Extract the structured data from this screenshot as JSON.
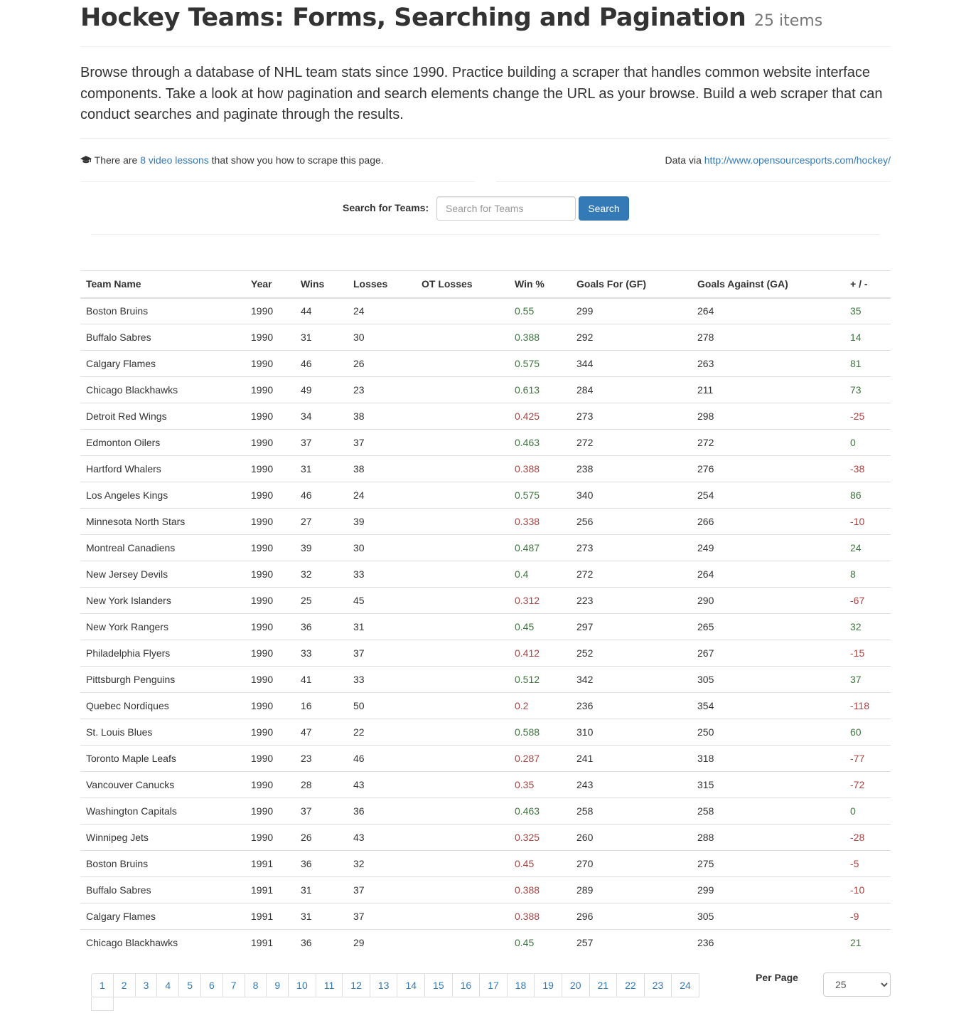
{
  "header": {
    "title": "Hockey Teams: Forms, Searching and Pagination",
    "count": "25 items"
  },
  "intro": "Browse through a database of NHL team stats since 1990. Practice building a scraper that handles common website interface components. Take a look at how pagination and search elements change the URL as your browse. Build a web scraper that can conduct searches and paginate through the results.",
  "info": {
    "icon": "graduation-cap-icon",
    "prefix": "There are",
    "lessons_link": "8 video lessons",
    "suffix": "that show you how to scrape this page.",
    "data_via": "Data via",
    "source_link": "http://www.opensourcesports.com/hockey/"
  },
  "search": {
    "label": "Search for Teams:",
    "placeholder": "Search for Teams",
    "value": "",
    "button": "Search"
  },
  "table": {
    "columns": [
      "Team Name",
      "Year",
      "Wins",
      "Losses",
      "OT Losses",
      "Win %",
      "Goals For (GF)",
      "Goals Against (GA)",
      "+ / -"
    ],
    "rows": [
      {
        "name": "Boston Bruins",
        "year": "1990",
        "wins": "44",
        "losses": "24",
        "ot": "",
        "pct": "0.55",
        "gf": "299",
        "ga": "264",
        "diff": "35",
        "status": "pos"
      },
      {
        "name": "Buffalo Sabres",
        "year": "1990",
        "wins": "31",
        "losses": "30",
        "ot": "",
        "pct": "0.388",
        "gf": "292",
        "ga": "278",
        "diff": "14",
        "status": "pos"
      },
      {
        "name": "Calgary Flames",
        "year": "1990",
        "wins": "46",
        "losses": "26",
        "ot": "",
        "pct": "0.575",
        "gf": "344",
        "ga": "263",
        "diff": "81",
        "status": "pos"
      },
      {
        "name": "Chicago Blackhawks",
        "year": "1990",
        "wins": "49",
        "losses": "23",
        "ot": "",
        "pct": "0.613",
        "gf": "284",
        "ga": "211",
        "diff": "73",
        "status": "pos"
      },
      {
        "name": "Detroit Red Wings",
        "year": "1990",
        "wins": "34",
        "losses": "38",
        "ot": "",
        "pct": "0.425",
        "gf": "273",
        "ga": "298",
        "diff": "-25",
        "status": "neg"
      },
      {
        "name": "Edmonton Oilers",
        "year": "1990",
        "wins": "37",
        "losses": "37",
        "ot": "",
        "pct": "0.463",
        "gf": "272",
        "ga": "272",
        "diff": "0",
        "status": "pos"
      },
      {
        "name": "Hartford Whalers",
        "year": "1990",
        "wins": "31",
        "losses": "38",
        "ot": "",
        "pct": "0.388",
        "gf": "238",
        "ga": "276",
        "diff": "-38",
        "status": "neg"
      },
      {
        "name": "Los Angeles Kings",
        "year": "1990",
        "wins": "46",
        "losses": "24",
        "ot": "",
        "pct": "0.575",
        "gf": "340",
        "ga": "254",
        "diff": "86",
        "status": "pos"
      },
      {
        "name": "Minnesota North Stars",
        "year": "1990",
        "wins": "27",
        "losses": "39",
        "ot": "",
        "pct": "0.338",
        "gf": "256",
        "ga": "266",
        "diff": "-10",
        "status": "neg"
      },
      {
        "name": "Montreal Canadiens",
        "year": "1990",
        "wins": "39",
        "losses": "30",
        "ot": "",
        "pct": "0.487",
        "gf": "273",
        "ga": "249",
        "diff": "24",
        "status": "pos"
      },
      {
        "name": "New Jersey Devils",
        "year": "1990",
        "wins": "32",
        "losses": "33",
        "ot": "",
        "pct": "0.4",
        "gf": "272",
        "ga": "264",
        "diff": "8",
        "status": "pos"
      },
      {
        "name": "New York Islanders",
        "year": "1990",
        "wins": "25",
        "losses": "45",
        "ot": "",
        "pct": "0.312",
        "gf": "223",
        "ga": "290",
        "diff": "-67",
        "status": "neg"
      },
      {
        "name": "New York Rangers",
        "year": "1990",
        "wins": "36",
        "losses": "31",
        "ot": "",
        "pct": "0.45",
        "gf": "297",
        "ga": "265",
        "diff": "32",
        "status": "pos"
      },
      {
        "name": "Philadelphia Flyers",
        "year": "1990",
        "wins": "33",
        "losses": "37",
        "ot": "",
        "pct": "0.412",
        "gf": "252",
        "ga": "267",
        "diff": "-15",
        "status": "neg"
      },
      {
        "name": "Pittsburgh Penguins",
        "year": "1990",
        "wins": "41",
        "losses": "33",
        "ot": "",
        "pct": "0.512",
        "gf": "342",
        "ga": "305",
        "diff": "37",
        "status": "pos"
      },
      {
        "name": "Quebec Nordiques",
        "year": "1990",
        "wins": "16",
        "losses": "50",
        "ot": "",
        "pct": "0.2",
        "gf": "236",
        "ga": "354",
        "diff": "-118",
        "status": "neg"
      },
      {
        "name": "St. Louis Blues",
        "year": "1990",
        "wins": "47",
        "losses": "22",
        "ot": "",
        "pct": "0.588",
        "gf": "310",
        "ga": "250",
        "diff": "60",
        "status": "pos"
      },
      {
        "name": "Toronto Maple Leafs",
        "year": "1990",
        "wins": "23",
        "losses": "46",
        "ot": "",
        "pct": "0.287",
        "gf": "241",
        "ga": "318",
        "diff": "-77",
        "status": "neg"
      },
      {
        "name": "Vancouver Canucks",
        "year": "1990",
        "wins": "28",
        "losses": "43",
        "ot": "",
        "pct": "0.35",
        "gf": "243",
        "ga": "315",
        "diff": "-72",
        "status": "neg"
      },
      {
        "name": "Washington Capitals",
        "year": "1990",
        "wins": "37",
        "losses": "36",
        "ot": "",
        "pct": "0.463",
        "gf": "258",
        "ga": "258",
        "diff": "0",
        "status": "pos"
      },
      {
        "name": "Winnipeg Jets",
        "year": "1990",
        "wins": "26",
        "losses": "43",
        "ot": "",
        "pct": "0.325",
        "gf": "260",
        "ga": "288",
        "diff": "-28",
        "status": "neg"
      },
      {
        "name": "Boston Bruins",
        "year": "1991",
        "wins": "36",
        "losses": "32",
        "ot": "",
        "pct": "0.45",
        "gf": "270",
        "ga": "275",
        "diff": "-5",
        "status": "neg"
      },
      {
        "name": "Buffalo Sabres",
        "year": "1991",
        "wins": "31",
        "losses": "37",
        "ot": "",
        "pct": "0.388",
        "gf": "289",
        "ga": "299",
        "diff": "-10",
        "status": "neg"
      },
      {
        "name": "Calgary Flames",
        "year": "1991",
        "wins": "31",
        "losses": "37",
        "ot": "",
        "pct": "0.388",
        "gf": "296",
        "ga": "305",
        "diff": "-9",
        "status": "neg"
      },
      {
        "name": "Chicago Blackhawks",
        "year": "1991",
        "wins": "36",
        "losses": "29",
        "ot": "",
        "pct": "0.45",
        "gf": "257",
        "ga": "236",
        "diff": "21",
        "status": "pos"
      }
    ]
  },
  "pagination": {
    "pages": [
      "1",
      "2",
      "3",
      "4",
      "5",
      "6",
      "7",
      "8",
      "9",
      "10",
      "11",
      "12",
      "13",
      "14",
      "15",
      "16",
      "17",
      "18",
      "19",
      "20",
      "21",
      "22",
      "23",
      "24"
    ],
    "per_page_label": "Per Page",
    "per_page_value": "25",
    "per_page_options": [
      "25"
    ]
  },
  "colors": {
    "link": "#337ab7",
    "success": "#3c763d",
    "danger": "#a94442",
    "button": "#337ab7"
  }
}
